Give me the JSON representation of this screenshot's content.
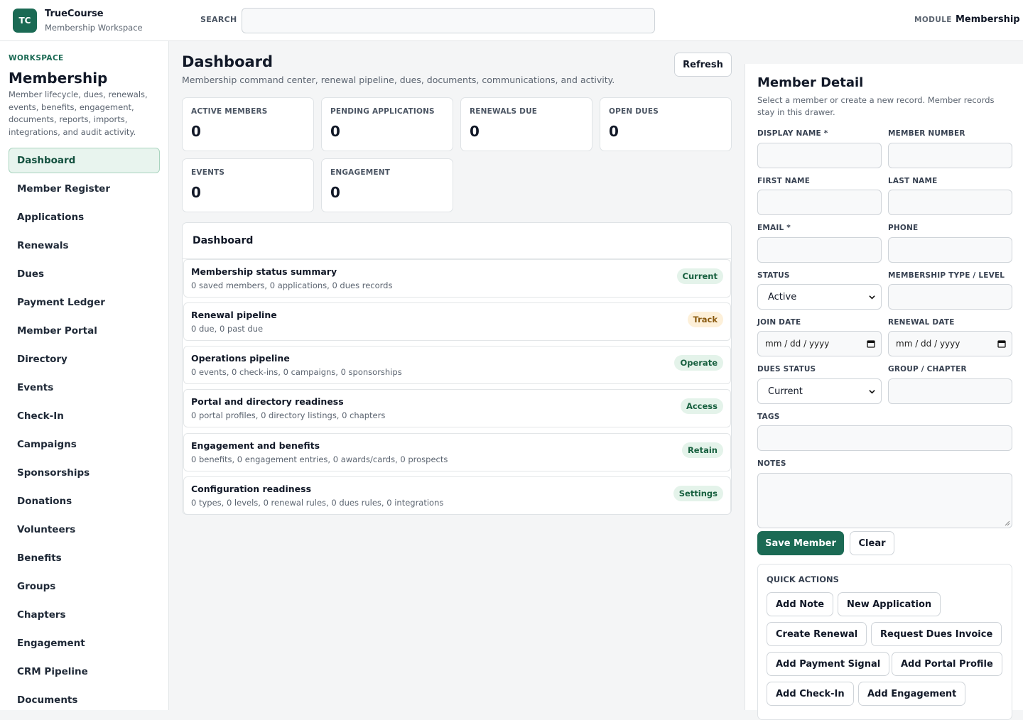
{
  "brand": {
    "initials": "TC",
    "title": "TrueCourse",
    "subtitle": "Membership Workspace"
  },
  "search": {
    "label": "SEARCH",
    "value": "",
    "placeholder": ""
  },
  "module": {
    "label": "MODULE",
    "value": "Membership"
  },
  "sidebar": {
    "workspace_label": "WORKSPACE",
    "title": "Membership",
    "description": "Member lifecycle, dues, renewals, events, benefits, engagement, documents, reports, imports, integrations, and audit activity.",
    "items": [
      {
        "label": "Dashboard"
      },
      {
        "label": "Member Register"
      },
      {
        "label": "Applications"
      },
      {
        "label": "Renewals"
      },
      {
        "label": "Dues"
      },
      {
        "label": "Payment Ledger"
      },
      {
        "label": "Member Portal"
      },
      {
        "label": "Directory"
      },
      {
        "label": "Events"
      },
      {
        "label": "Check-In"
      },
      {
        "label": "Campaigns"
      },
      {
        "label": "Sponsorships"
      },
      {
        "label": "Donations"
      },
      {
        "label": "Volunteers"
      },
      {
        "label": "Benefits"
      },
      {
        "label": "Groups"
      },
      {
        "label": "Chapters"
      },
      {
        "label": "Engagement"
      },
      {
        "label": "CRM Pipeline"
      },
      {
        "label": "Documents"
      }
    ]
  },
  "main": {
    "title": "Dashboard",
    "subtitle": "Membership command center, renewal pipeline, dues, documents, communications, and activity.",
    "refresh_label": "Refresh",
    "stats": [
      {
        "label": "ACTIVE MEMBERS",
        "value": "0"
      },
      {
        "label": "PENDING APPLICATIONS",
        "value": "0"
      },
      {
        "label": "RENEWALS DUE",
        "value": "0"
      },
      {
        "label": "OPEN DUES",
        "value": "0"
      },
      {
        "label": "EVENTS",
        "value": "0"
      },
      {
        "label": "ENGAGEMENT",
        "value": "0"
      }
    ],
    "panel": {
      "title": "Dashboard",
      "rows": [
        {
          "title": "Membership status summary",
          "subtitle": "0 saved members, 0 applications, 0 dues records",
          "badge": "Current",
          "badge_color": "#17603f"
        },
        {
          "title": "Renewal pipeline",
          "subtitle": "0 due, 0 past due",
          "badge": "Track",
          "badge_color": "#8a5a10"
        },
        {
          "title": "Operations pipeline",
          "subtitle": "0 events, 0 check-ins, 0 campaigns, 0 sponsorships",
          "badge": "Operate",
          "badge_color": "#17603f"
        },
        {
          "title": "Portal and directory readiness",
          "subtitle": "0 portal profiles, 0 directory listings, 0 chapters",
          "badge": "Access",
          "badge_color": "#17603f"
        },
        {
          "title": "Engagement and benefits",
          "subtitle": "0 benefits, 0 engagement entries, 0 awards/cards, 0 prospects",
          "badge": "Retain",
          "badge_color": "#17603f"
        },
        {
          "title": "Configuration readiness",
          "subtitle": "0 types, 0 levels, 0 renewal rules, 0 dues rules, 0 integrations",
          "badge": "Settings",
          "badge_color": "#17603f"
        }
      ]
    }
  },
  "drawer": {
    "title": "Member Detail",
    "subtitle": "Select a member or create a new record. Member records stay in this drawer.",
    "fields": {
      "display_name": {
        "label": "DISPLAY NAME *",
        "value": ""
      },
      "member_number": {
        "label": "MEMBER NUMBER",
        "value": ""
      },
      "first_name": {
        "label": "FIRST NAME",
        "value": ""
      },
      "last_name": {
        "label": "LAST NAME",
        "value": ""
      },
      "email": {
        "label": "EMAIL *",
        "value": ""
      },
      "phone": {
        "label": "PHONE",
        "value": ""
      },
      "status": {
        "label": "STATUS",
        "value": "Active"
      },
      "membership_type": {
        "label": "MEMBERSHIP TYPE / LEVEL",
        "value": ""
      },
      "join_date": {
        "label": "JOIN DATE",
        "value": "mm / dd / yyyy"
      },
      "renewal_date": {
        "label": "RENEWAL DATE",
        "value": "mm / dd / yyyy"
      },
      "dues_status": {
        "label": "DUES STATUS",
        "value": "Current"
      },
      "group_chapter": {
        "label": "GROUP / CHAPTER",
        "value": ""
      },
      "tags": {
        "label": "TAGS",
        "value": ""
      },
      "notes": {
        "label": "NOTES",
        "value": ""
      }
    },
    "save_label": "Save Member",
    "clear_label": "Clear",
    "quick_actions": {
      "title": "QUICK ACTIONS",
      "buttons": [
        "Add Note",
        "New Application",
        "Create Renewal",
        "Request Dues Invoice",
        "Add Payment Signal",
        "Add Portal Profile",
        "Add Check-In",
        "Add Engagement"
      ]
    }
  },
  "colors": {
    "accent": "#1b6a54",
    "accent_light": "#e8f4ee",
    "badge_green_bg": "#e4f3ea",
    "badge_amber_bg": "#fdf0d9"
  }
}
